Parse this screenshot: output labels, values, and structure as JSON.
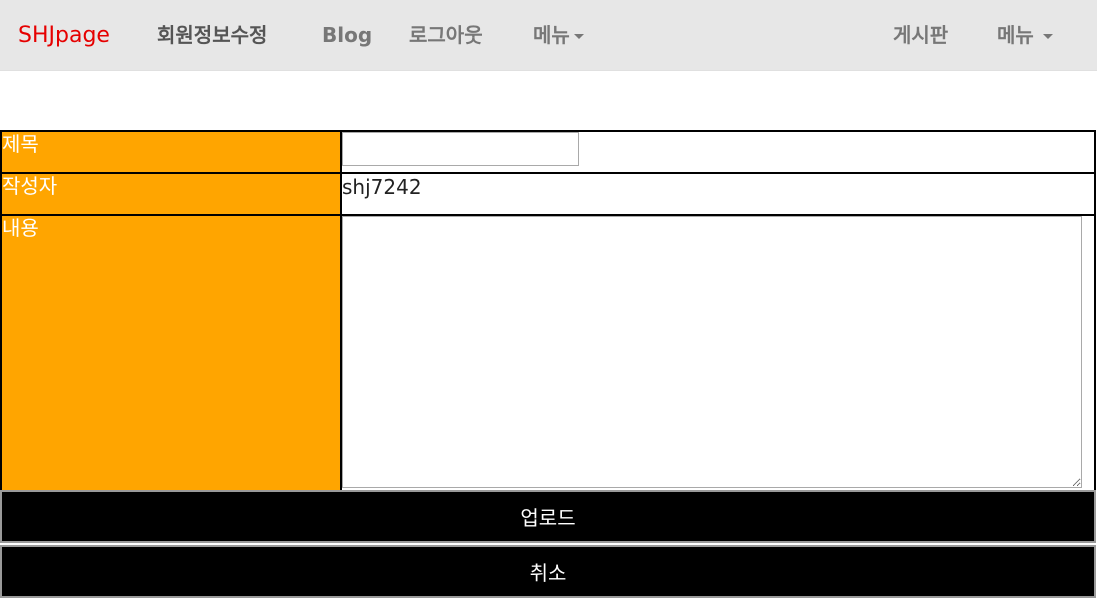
{
  "navbar": {
    "brand": "SHJpage",
    "left_items": [
      {
        "label": "회원정보수정"
      },
      {
        "label": "Blog"
      },
      {
        "label": "로그아웃"
      },
      {
        "label": "메뉴"
      }
    ],
    "right_items": [
      {
        "label": "게시판"
      },
      {
        "label": "메뉴"
      }
    ],
    "brand_color": "#e60000",
    "background_color": "#e7e7e7"
  },
  "form": {
    "title_label": "제목",
    "title_value": "",
    "writer_label": "작성자",
    "writer_value": "shj7242",
    "content_label": "내용",
    "content_value": "",
    "label_bg_color": "#ffa500"
  },
  "buttons": {
    "upload_label": "업로드",
    "cancel_label": "취소",
    "button_color": "#000000"
  }
}
